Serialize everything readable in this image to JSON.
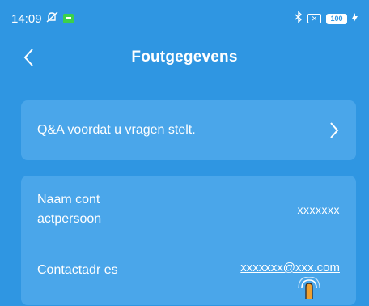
{
  "status": {
    "time": "14:09",
    "battery": "100"
  },
  "header": {
    "title": "Foutgegevens"
  },
  "faq": {
    "label": "Q&A voordat u vragen stelt."
  },
  "contact_name": {
    "label": "Naam cont actpersoon",
    "value": "xxxxxxx"
  },
  "contact_address": {
    "label": "Contactadr es",
    "value": "xxxxxxx@xxx.com"
  },
  "colors": {
    "background": "#2f96e2",
    "card": "#4aa6ea",
    "text": "#ffffff"
  }
}
